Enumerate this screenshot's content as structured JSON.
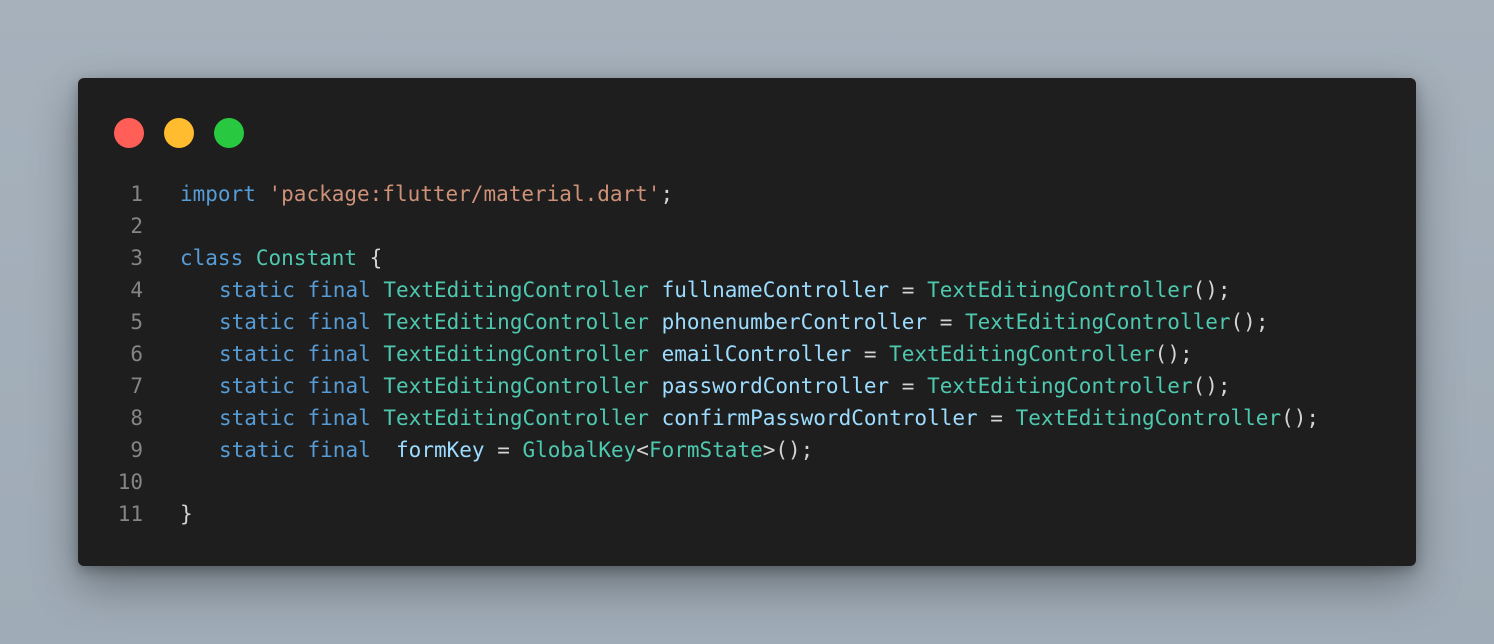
{
  "window": {
    "buttons": [
      {
        "name": "close",
        "color": "#ff5f57"
      },
      {
        "name": "minimize",
        "color": "#febc2e"
      },
      {
        "name": "maximize",
        "color": "#28c840"
      }
    ]
  },
  "code": {
    "lines": [
      {
        "n": "1",
        "tokens": [
          {
            "t": "import",
            "c": "kw"
          },
          {
            "t": " ",
            "c": "punc"
          },
          {
            "t": "'package:flutter/material.dart'",
            "c": "str"
          },
          {
            "t": ";",
            "c": "punc"
          }
        ]
      },
      {
        "n": "2",
        "tokens": []
      },
      {
        "n": "3",
        "tokens": [
          {
            "t": "class",
            "c": "kw"
          },
          {
            "t": " ",
            "c": "punc"
          },
          {
            "t": "Constant",
            "c": "type"
          },
          {
            "t": " {",
            "c": "punc"
          }
        ]
      },
      {
        "n": "4",
        "indent": true,
        "tokens": [
          {
            "t": "static",
            "c": "kw"
          },
          {
            "t": " ",
            "c": "punc"
          },
          {
            "t": "final",
            "c": "kw"
          },
          {
            "t": " ",
            "c": "punc"
          },
          {
            "t": "TextEditingController",
            "c": "type"
          },
          {
            "t": " ",
            "c": "punc"
          },
          {
            "t": "fullnameController",
            "c": "var"
          },
          {
            "t": " = ",
            "c": "punc"
          },
          {
            "t": "TextEditingController",
            "c": "type"
          },
          {
            "t": "();",
            "c": "punc"
          }
        ]
      },
      {
        "n": "5",
        "indent": true,
        "tokens": [
          {
            "t": "static",
            "c": "kw"
          },
          {
            "t": " ",
            "c": "punc"
          },
          {
            "t": "final",
            "c": "kw"
          },
          {
            "t": " ",
            "c": "punc"
          },
          {
            "t": "TextEditingController",
            "c": "type"
          },
          {
            "t": " ",
            "c": "punc"
          },
          {
            "t": "phonenumberController",
            "c": "var"
          },
          {
            "t": " = ",
            "c": "punc"
          },
          {
            "t": "TextEditingController",
            "c": "type"
          },
          {
            "t": "();",
            "c": "punc"
          }
        ]
      },
      {
        "n": "6",
        "indent": true,
        "tokens": [
          {
            "t": "static",
            "c": "kw"
          },
          {
            "t": " ",
            "c": "punc"
          },
          {
            "t": "final",
            "c": "kw"
          },
          {
            "t": " ",
            "c": "punc"
          },
          {
            "t": "TextEditingController",
            "c": "type"
          },
          {
            "t": " ",
            "c": "punc"
          },
          {
            "t": "emailController",
            "c": "var"
          },
          {
            "t": " = ",
            "c": "punc"
          },
          {
            "t": "TextEditingController",
            "c": "type"
          },
          {
            "t": "();",
            "c": "punc"
          }
        ]
      },
      {
        "n": "7",
        "indent": true,
        "tokens": [
          {
            "t": "static",
            "c": "kw"
          },
          {
            "t": " ",
            "c": "punc"
          },
          {
            "t": "final",
            "c": "kw"
          },
          {
            "t": " ",
            "c": "punc"
          },
          {
            "t": "TextEditingController",
            "c": "type"
          },
          {
            "t": " ",
            "c": "punc"
          },
          {
            "t": "passwordController",
            "c": "var"
          },
          {
            "t": " = ",
            "c": "punc"
          },
          {
            "t": "TextEditingController",
            "c": "type"
          },
          {
            "t": "();",
            "c": "punc"
          }
        ]
      },
      {
        "n": "8",
        "indent": true,
        "tokens": [
          {
            "t": "static",
            "c": "kw"
          },
          {
            "t": " ",
            "c": "punc"
          },
          {
            "t": "final",
            "c": "kw"
          },
          {
            "t": " ",
            "c": "punc"
          },
          {
            "t": "TextEditingController",
            "c": "type"
          },
          {
            "t": " ",
            "c": "punc"
          },
          {
            "t": "confirmPasswordController",
            "c": "var"
          },
          {
            "t": " = ",
            "c": "punc"
          },
          {
            "t": "TextEditingController",
            "c": "type"
          },
          {
            "t": "();",
            "c": "punc"
          }
        ]
      },
      {
        "n": "9",
        "indent": true,
        "tokens": [
          {
            "t": "static",
            "c": "kw"
          },
          {
            "t": " ",
            "c": "punc"
          },
          {
            "t": "final",
            "c": "kw"
          },
          {
            "t": "  ",
            "c": "punc"
          },
          {
            "t": "formKey",
            "c": "var"
          },
          {
            "t": " = ",
            "c": "punc"
          },
          {
            "t": "GlobalKey",
            "c": "type"
          },
          {
            "t": "<",
            "c": "punc"
          },
          {
            "t": "FormState",
            "c": "type"
          },
          {
            "t": ">();",
            "c": "punc"
          }
        ]
      },
      {
        "n": "10",
        "tokens": []
      },
      {
        "n": "11",
        "tokens": [
          {
            "t": "}",
            "c": "punc"
          }
        ]
      }
    ]
  }
}
